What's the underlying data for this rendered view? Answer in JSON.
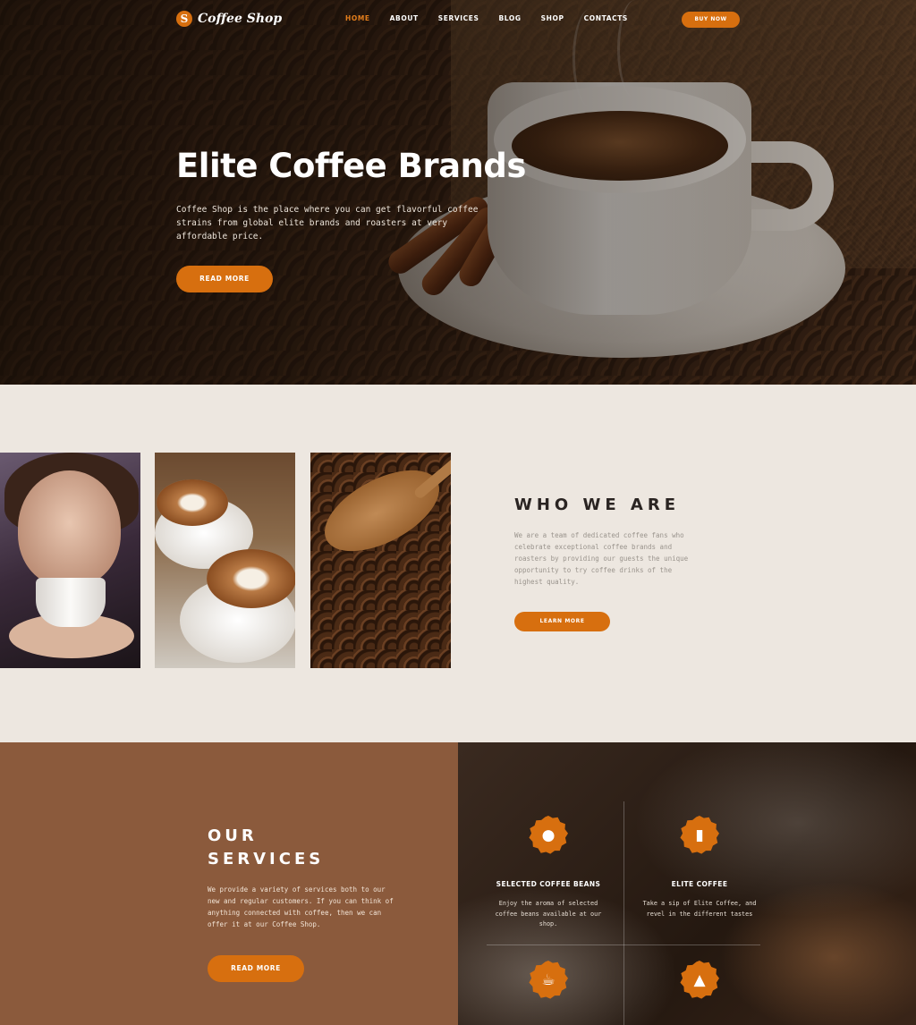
{
  "nav": {
    "logo": "Coffee Shop",
    "links": [
      "HOME",
      "ABOUT",
      "SERVICES",
      "BLOG",
      "SHOP",
      "CONTACTS"
    ],
    "active": "HOME",
    "buy_label": "BUY NOW"
  },
  "hero": {
    "title": "Elite Coffee Brands",
    "text": "Coffee Shop is the place where you can get flavorful coffee strains from global elite brands and roasters at very affordable price.",
    "button": "READ MORE"
  },
  "who": {
    "title": "WHO WE ARE",
    "text": "We are a team of dedicated coffee fans who celebrate exceptional coffee brands and roasters by providing our guests the unique opportunity to try coffee drinks of the highest quality.",
    "button": "LEARN MORE"
  },
  "services": {
    "title_line1": "OUR",
    "title_line2": "SERVICES",
    "text": "We provide a variety of services both to our new and regular customers. If you can think of anything connected with coffee, then we can offer it at our Coffee Shop.",
    "button": "READ MORE",
    "items": [
      {
        "title": "SELECTED COFFEE BEANS",
        "text": "Enjoy the aroma of selected coffee beans available at our shop.",
        "icon": "coffee-bean-icon"
      },
      {
        "title": "ELITE COFFEE",
        "text": "Take a sip of Elite Coffee, and revel in the different tastes",
        "icon": "coffee-bag-icon"
      },
      {
        "title": "",
        "text": "",
        "icon": "coffee-pot-icon"
      },
      {
        "title": "",
        "text": "",
        "icon": "turkish-coffee-pot-icon"
      }
    ]
  },
  "colors": {
    "accent": "#d76f0f",
    "services_bg": "#8b5a3c",
    "section_bg": "#ede7e0",
    "heading_dark": "#2a2422"
  }
}
